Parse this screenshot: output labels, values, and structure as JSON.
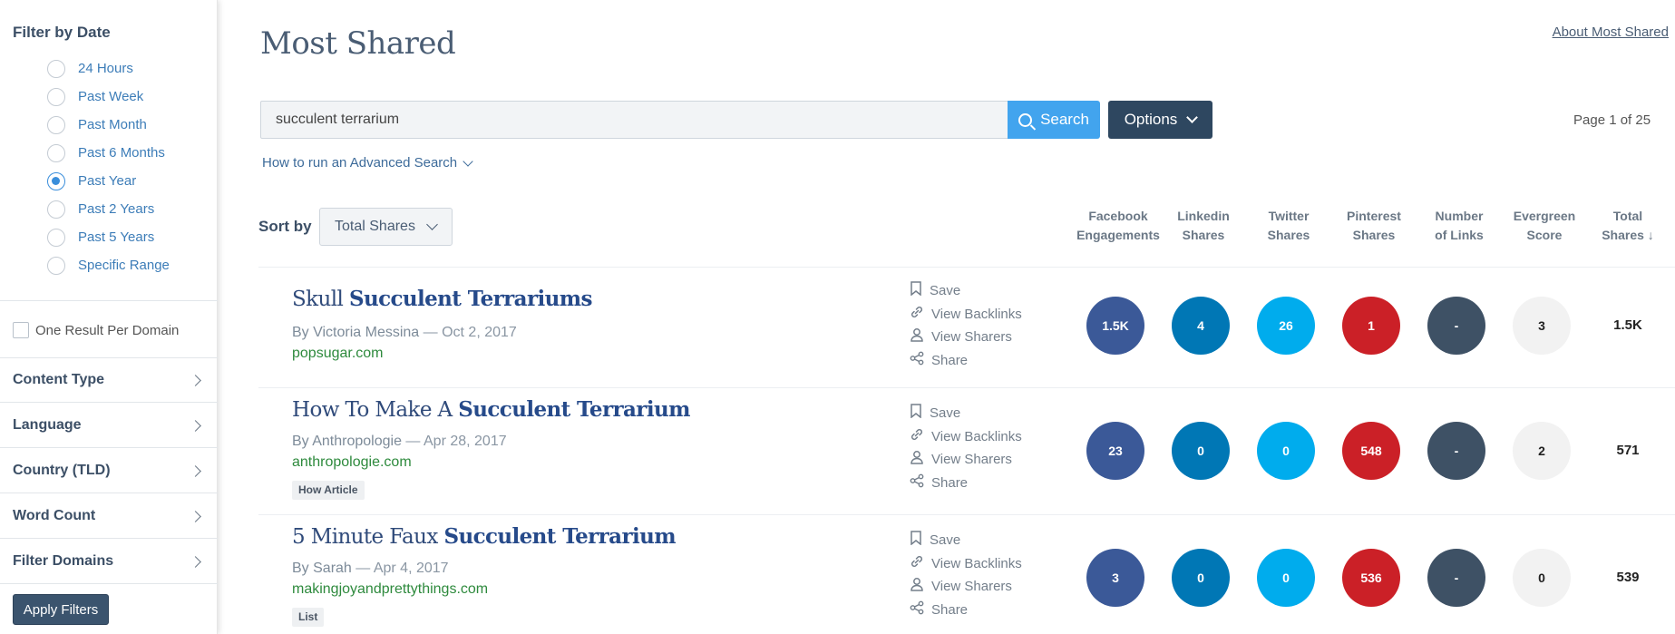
{
  "sidebar": {
    "filter_title": "Filter by Date",
    "date_options": [
      {
        "label": "24 Hours",
        "checked": false
      },
      {
        "label": "Past Week",
        "checked": false
      },
      {
        "label": "Past Month",
        "checked": false
      },
      {
        "label": "Past 6 Months",
        "checked": false
      },
      {
        "label": "Past Year",
        "checked": true
      },
      {
        "label": "Past 2 Years",
        "checked": false
      },
      {
        "label": "Past 5 Years",
        "checked": false
      },
      {
        "label": "Specific Range",
        "checked": false
      }
    ],
    "one_result_label": "One Result Per Domain",
    "sections": [
      "Content Type",
      "Language",
      "Country (TLD)",
      "Word Count",
      "Filter Domains"
    ],
    "apply_label": "Apply Filters"
  },
  "header": {
    "title": "Most Shared",
    "about_link": "About Most Shared"
  },
  "search": {
    "value": "succulent terrarium",
    "button_label": "Search",
    "options_label": "Options",
    "page_info": "Page 1 of 25",
    "advanced_link": "How to run an Advanced Search"
  },
  "sort": {
    "label": "Sort by",
    "value": "Total Shares"
  },
  "columns": [
    {
      "line1": "Facebook",
      "line2": "Engagements"
    },
    {
      "line1": "Linkedin",
      "line2": "Shares"
    },
    {
      "line1": "Twitter",
      "line2": "Shares"
    },
    {
      "line1": "Pinterest",
      "line2": "Shares"
    },
    {
      "line1": "Number",
      "line2": "of Links"
    },
    {
      "line1": "Evergreen",
      "line2": "Score"
    },
    {
      "line1": "Total",
      "line2": "Shares ↓"
    }
  ],
  "actions": [
    "Save",
    "View Backlinks",
    "View Sharers",
    "Share"
  ],
  "colors": {
    "facebook": "#3b5998",
    "linkedin": "#0077b5",
    "twitter": "#00aced",
    "pinterest": "#cb2027",
    "links": "#3e5165",
    "evergreen": "#f2f2f2"
  },
  "results": [
    {
      "title_plain": "Skull ",
      "title_bold": "Succulent Terrariums",
      "author": "By Victoria Messina",
      "date": " — Oct 2, 2017",
      "domain": "popsugar.com",
      "tag": "",
      "metrics": [
        "1.5K",
        "4",
        "26",
        "1",
        "-",
        "3"
      ],
      "total": "1.5K"
    },
    {
      "title_plain": "How To Make A ",
      "title_bold": "Succulent Terrarium",
      "author": "By Anthropologie",
      "date": " — Apr 28, 2017",
      "domain": "anthropologie.com",
      "tag": "How Article",
      "metrics": [
        "23",
        "0",
        "0",
        "548",
        "-",
        "2"
      ],
      "total": "571"
    },
    {
      "title_plain": "5 Minute Faux ",
      "title_bold": "Succulent Terrarium",
      "author": "By Sarah",
      "date": " — Apr 4, 2017",
      "domain": "makingjoyandprettythings.com",
      "tag": "List",
      "metrics": [
        "3",
        "0",
        "0",
        "536",
        "-",
        "0"
      ],
      "total": "539"
    }
  ]
}
